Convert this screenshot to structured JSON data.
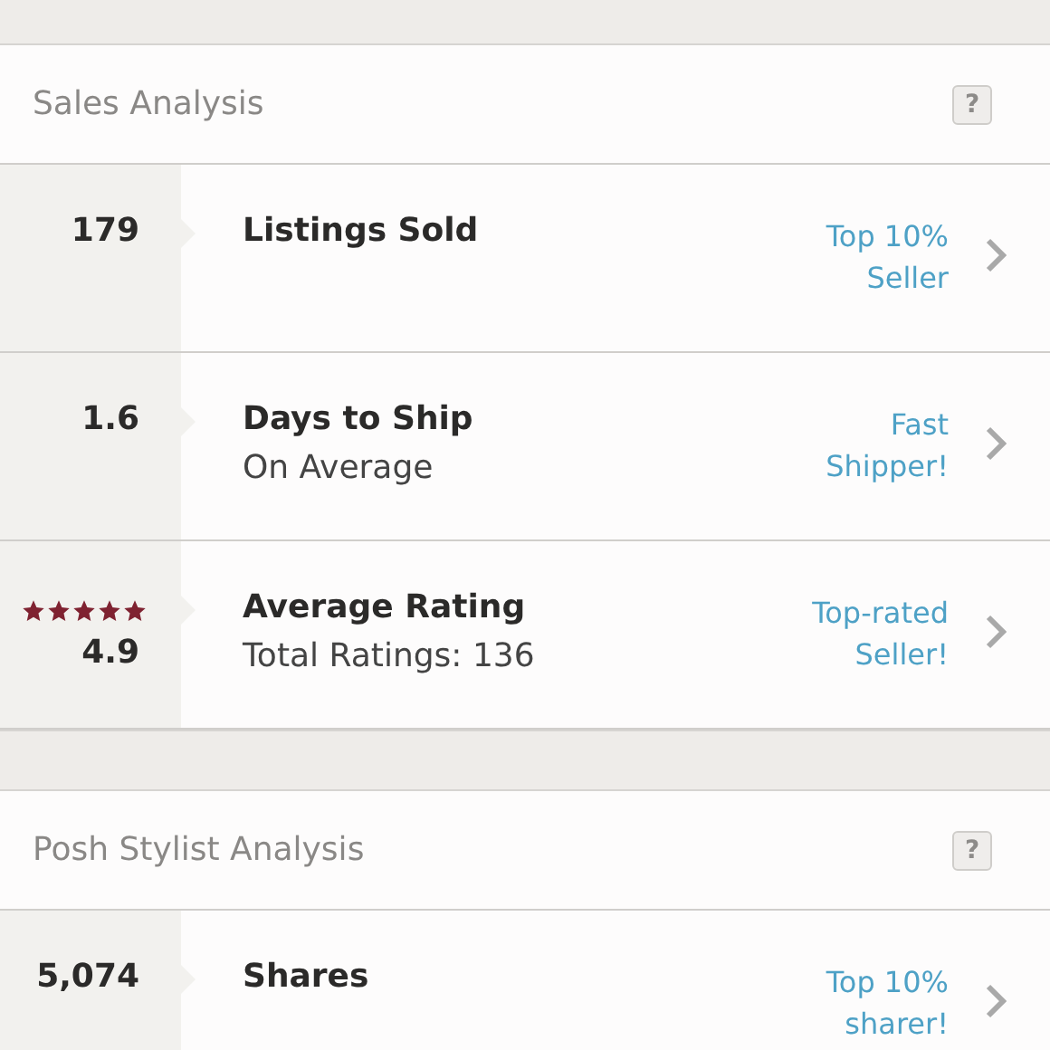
{
  "sections": [
    {
      "title": "Sales Analysis",
      "help": "?",
      "rows": [
        {
          "value": "179",
          "title": "Listings Sold",
          "badge": "Top 10%\nSeller"
        },
        {
          "value": "1.6",
          "title": "Days to Ship",
          "subtitle": "On Average",
          "badge": "Fast\nShipper!"
        },
        {
          "value": "4.9",
          "stars": 5,
          "title": "Average Rating",
          "subtitle": "Total Ratings: 136",
          "badge": "Top-rated\nSeller!"
        }
      ]
    },
    {
      "title": "Posh Stylist Analysis",
      "help": "?",
      "rows": [
        {
          "value": "5,074",
          "title": "Shares",
          "badge": "Top 10%\nsharer!"
        }
      ]
    }
  ]
}
